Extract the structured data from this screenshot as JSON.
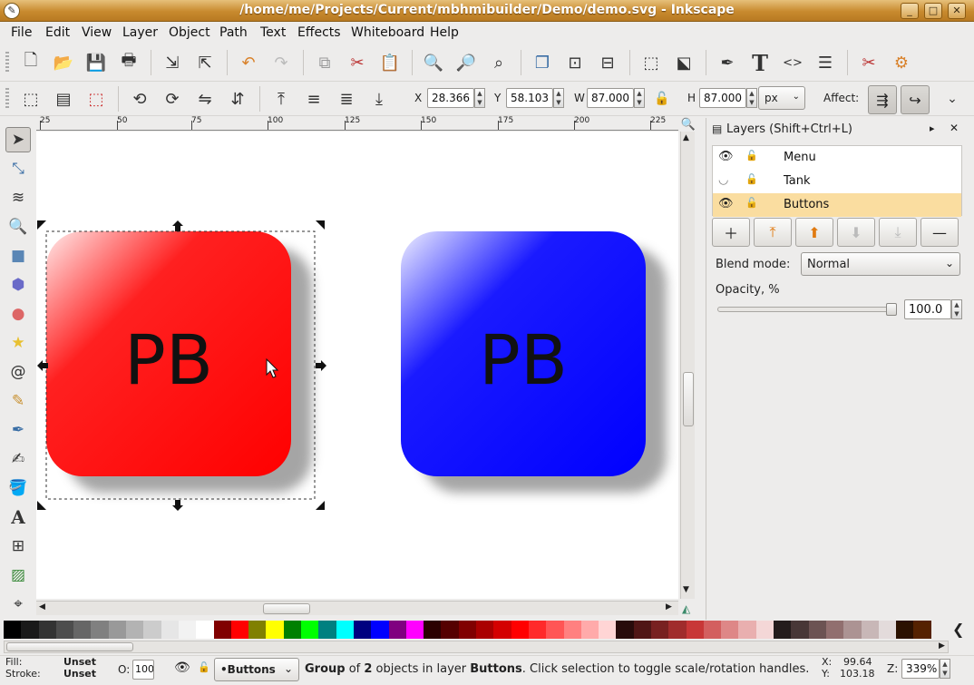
{
  "window": {
    "title": "/home/me/Projects/Current/mbhmibuilder/Demo/demo.svg - Inkscape",
    "minimize": "_",
    "maximize": "□",
    "close": "✕"
  },
  "menu": [
    "File",
    "Edit",
    "View",
    "Layer",
    "Object",
    "Path",
    "Text",
    "Effects",
    "Whiteboard",
    "Help"
  ],
  "controls": {
    "x_label": "X",
    "x_value": "28.366",
    "y_label": "Y",
    "y_value": "58.103",
    "w_label": "W",
    "w_value": "87.000",
    "h_label": "H",
    "h_value": "87.000",
    "unit": "px",
    "affect_label": "Affect:"
  },
  "ruler": {
    "labels": [
      "25",
      "50",
      "75",
      "100",
      "125",
      "150",
      "175",
      "200",
      "225"
    ]
  },
  "canvas": {
    "red_button_text": "PB",
    "blue_button_text": "PB",
    "colors": {
      "red": "#ff0000",
      "blue": "#0000ff"
    }
  },
  "layers_panel": {
    "title": "Layers (Shift+Ctrl+L)",
    "layers": [
      {
        "name": "Menu",
        "visible": true,
        "locked": false
      },
      {
        "name": "Tank",
        "visible": false,
        "locked": false
      },
      {
        "name": "Buttons",
        "visible": true,
        "locked": false,
        "selected": true
      }
    ],
    "blend_label": "Blend mode:",
    "blend_value": "Normal",
    "opacity_label": "Opacity, %",
    "opacity_value": "100.0",
    "opacity_fraction": 1.0
  },
  "palette": [
    "#000000",
    "#1a1a1a",
    "#333333",
    "#4d4d4d",
    "#666666",
    "#808080",
    "#999999",
    "#b3b3b3",
    "#cccccc",
    "#e6e6e6",
    "#f2f2f2",
    "#ffffff",
    "#800000",
    "#ff0000",
    "#808000",
    "#ffff00",
    "#008000",
    "#00ff00",
    "#008080",
    "#00ffff",
    "#000080",
    "#0000ff",
    "#800080",
    "#ff00ff",
    "#2b0000",
    "#550000",
    "#800000",
    "#aa0000",
    "#d40000",
    "#ff0000",
    "#ff2a2a",
    "#ff5555",
    "#ff8080",
    "#ffaaaa",
    "#ffd5d5",
    "#280b0b",
    "#501616",
    "#782121",
    "#a02c2c",
    "#c83737",
    "#d35f5f",
    "#de8787",
    "#e9afaf",
    "#f4d7d7",
    "#241c1c",
    "#483737",
    "#6c5353",
    "#916f6f",
    "#ac9393",
    "#c8b7b7",
    "#e3dbdb",
    "#2b1100",
    "#552200"
  ],
  "status": {
    "fill_label": "Fill:",
    "fill_value": "Unset",
    "stroke_label": "Stroke:",
    "stroke_value": "Unset",
    "opacity_label": "O:",
    "opacity_value": "100",
    "layer": "•Buttons",
    "msg_part1": "Group",
    "msg_part2": " of ",
    "msg_part3": "2",
    "msg_part4": " objects in layer ",
    "msg_part5": "Buttons",
    "msg_part6": ". Click selection to toggle scale/rotation handles.",
    "x_label": "X:",
    "x_value": "99.64",
    "y_label": "Y:",
    "y_value": "103.18",
    "z_label": "Z:",
    "zoom": "339%"
  }
}
